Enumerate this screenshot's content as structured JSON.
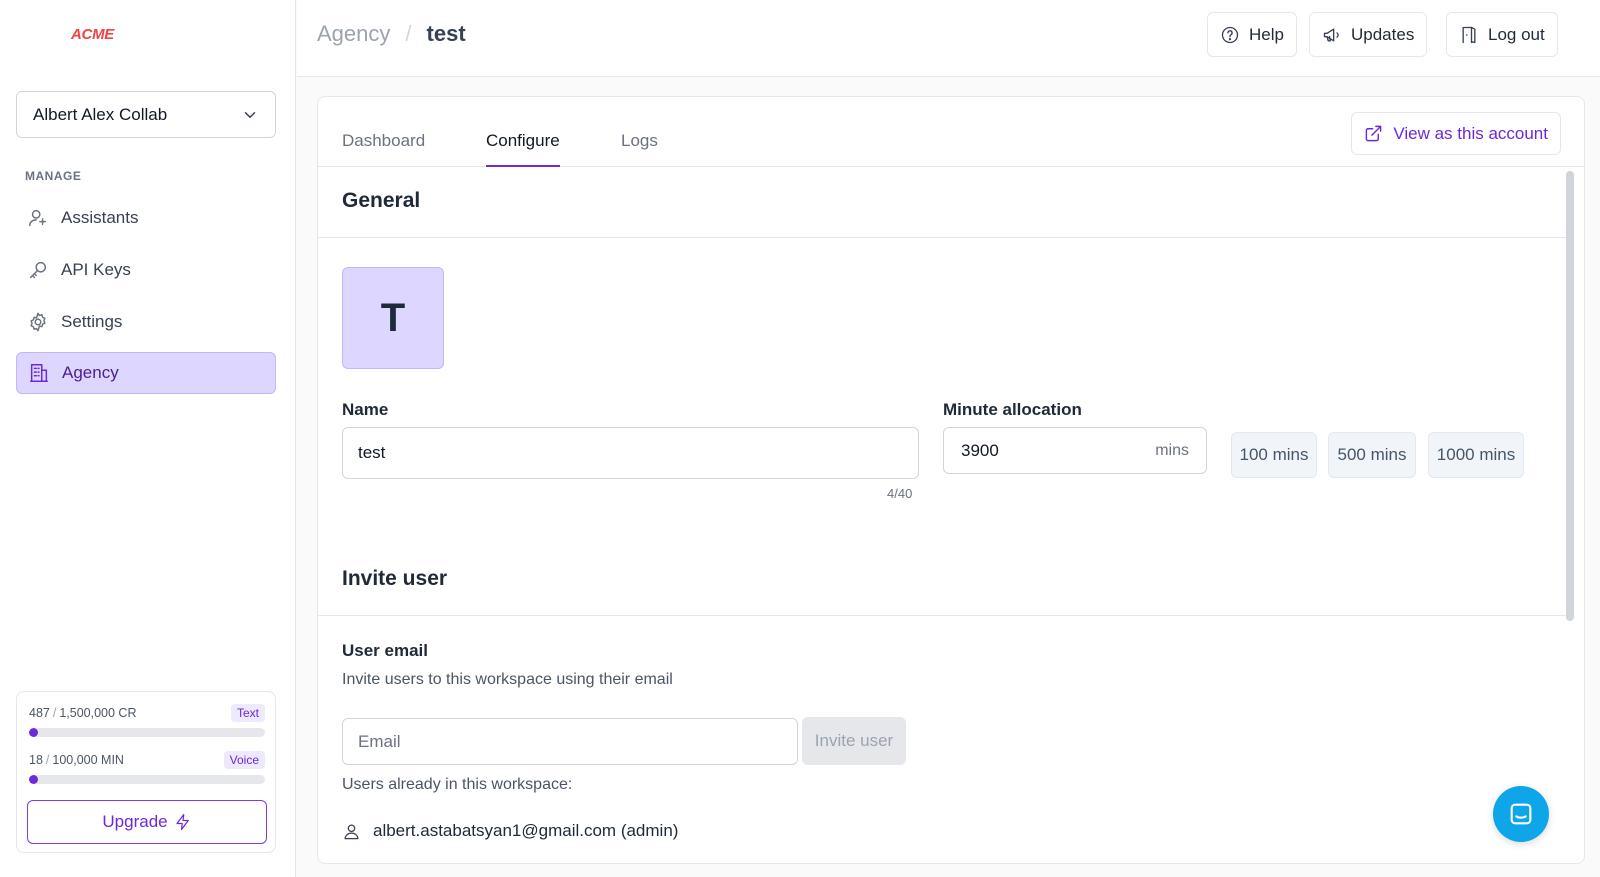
{
  "brand": {
    "logo_text": "ACME",
    "logo_color": "#ef4444"
  },
  "sidebar": {
    "account_name": "Albert Alex Collab",
    "section_label": "MANAGE",
    "items": [
      {
        "label": "Assistants",
        "icon": "user-plus-icon",
        "active": false
      },
      {
        "label": "API Keys",
        "icon": "key-icon",
        "active": false
      },
      {
        "label": "Settings",
        "icon": "gear-icon",
        "active": false
      },
      {
        "label": "Agency",
        "icon": "building-icon",
        "active": true
      }
    ],
    "usage": {
      "text": {
        "used": "487",
        "limit": "1,500,000 CR",
        "tag": "Text",
        "fraction": 0.0003
      },
      "voice": {
        "used": "18",
        "limit": "100,000 MIN",
        "tag": "Voice",
        "fraction": 0.0002
      },
      "upgrade_label": "Upgrade"
    }
  },
  "header": {
    "breadcrumb": [
      "Agency",
      "test"
    ],
    "buttons": {
      "help": "Help",
      "updates": "Updates",
      "logout": "Log out"
    }
  },
  "tabs": [
    {
      "label": "Dashboard",
      "active": false
    },
    {
      "label": "Configure",
      "active": true
    },
    {
      "label": "Logs",
      "active": false
    }
  ],
  "view_as_label": "View as this account",
  "general": {
    "title": "General",
    "avatar_letter": "T",
    "name_label": "Name",
    "name_value": "test",
    "name_counter": "4/40",
    "minute_label": "Minute allocation",
    "minute_value": "3900",
    "minute_unit": "mins",
    "presets": [
      "100 mins",
      "500 mins",
      "1000 mins"
    ]
  },
  "invite": {
    "title": "Invite user",
    "email_label": "User email",
    "description": "Invite users to this workspace using their email",
    "email_placeholder": "Email",
    "button_label": "Invite user",
    "existing_label": "Users already in this workspace:",
    "users": [
      "albert.astabatsyan1@gmail.com (admin)"
    ]
  },
  "colors": {
    "accent": "#6d28d9",
    "accent_light": "#ddd6fe",
    "chat_fab": "#0ea5e9"
  }
}
